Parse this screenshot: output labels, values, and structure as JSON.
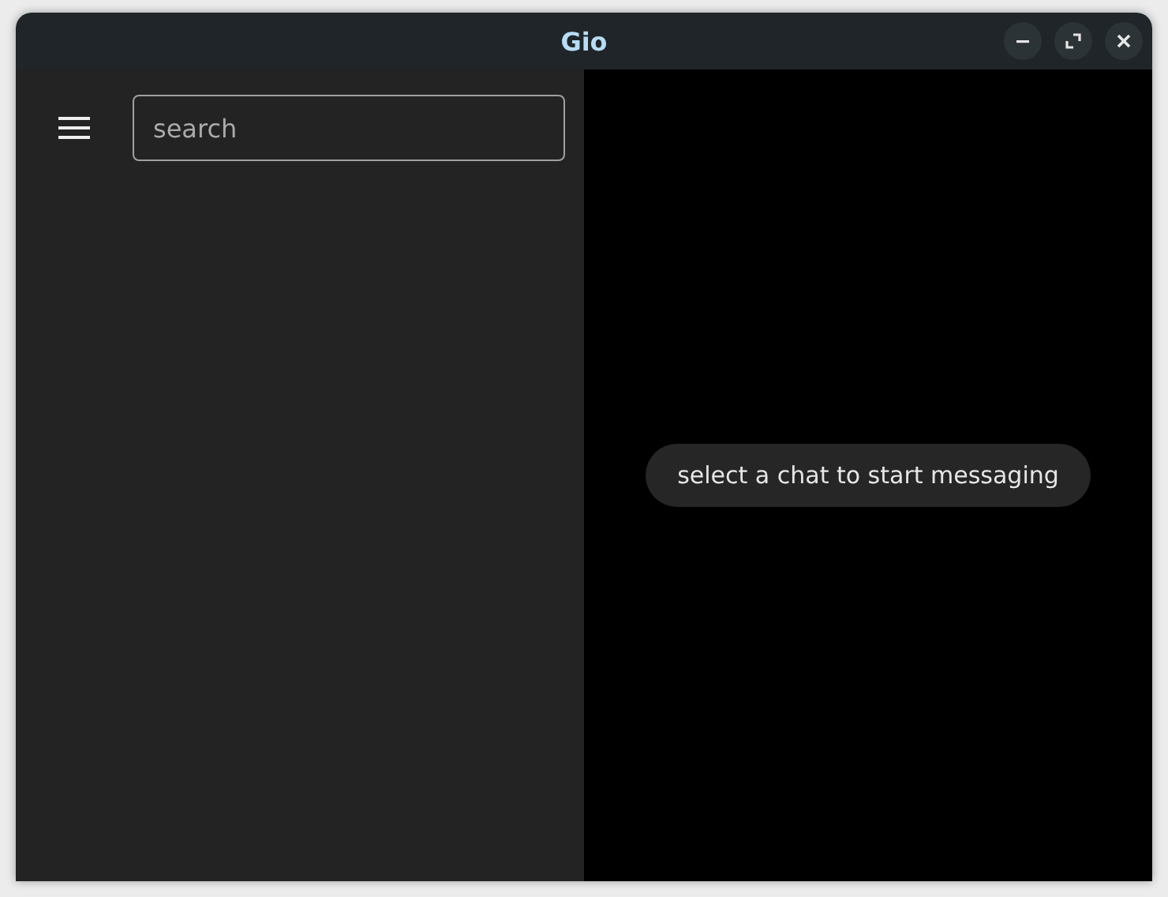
{
  "window": {
    "title": "Gio"
  },
  "search": {
    "placeholder": "search"
  },
  "empty_state": {
    "message": "select a chat to start messaging"
  }
}
